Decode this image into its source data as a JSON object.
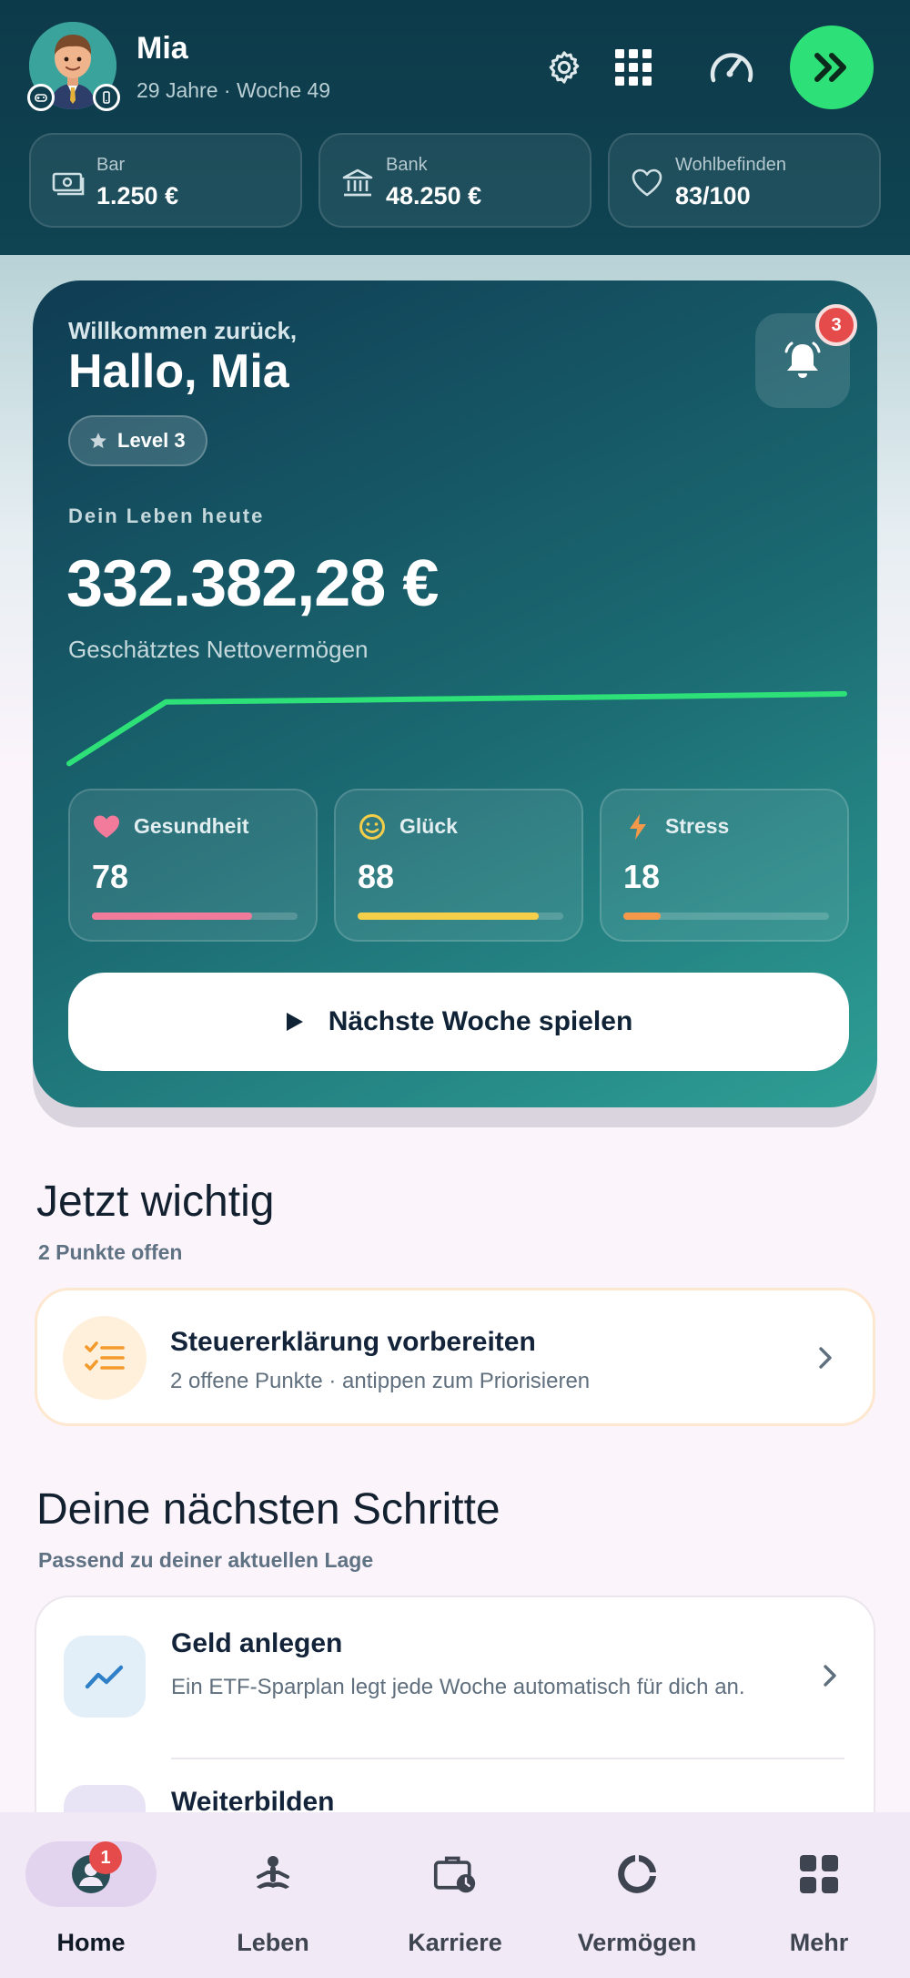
{
  "header": {
    "name": "Mia",
    "meta": "29 Jahre · Woche 49",
    "icons": [
      "gear-icon",
      "grid-icon",
      "speedometer-icon",
      "fast-forward-icon"
    ],
    "stats": [
      {
        "label": "Bar",
        "value": "1.250 €",
        "icon": "cash-icon"
      },
      {
        "label": "Bank",
        "value": "48.250 €",
        "icon": "bank-icon"
      },
      {
        "label": "Wohlbefinden",
        "value": "83/100",
        "icon": "heart-icon"
      }
    ]
  },
  "hero": {
    "welcome": "Willkommen zurück,",
    "greeting": "Hallo, Mia",
    "level": "Level 3",
    "notifications": "3",
    "life_label": "Dein Leben heute",
    "net_worth": "332.382,28 €",
    "net_worth_caption": "Geschätztes Nettovermögen",
    "trend": [
      0.12,
      0.58,
      0.59,
      0.6,
      0.61,
      0.62,
      0.63,
      0.64
    ],
    "metrics": [
      {
        "label": "Gesundheit",
        "value": "78",
        "level": 0.78,
        "color": "#f27a9b",
        "icon": "heart-icon"
      },
      {
        "label": "Glück",
        "value": "88",
        "level": 0.88,
        "color": "#f5cf4a",
        "icon": "smile-icon"
      },
      {
        "label": "Stress",
        "value": "18",
        "level": 0.18,
        "color": "#f4994a",
        "icon": "bolt-icon"
      }
    ],
    "play_label": "Nächste Woche spielen"
  },
  "important": {
    "title": "Jetzt wichtig",
    "subtitle": "2 Punkte offen",
    "task_title": "Steuererklärung vorbereiten",
    "task_sub": "2 offene Punkte · antippen zum Priorisieren"
  },
  "next_steps": {
    "title": "Deine nächsten Schritte",
    "subtitle": "Passend zu deiner aktuellen Lage",
    "items": [
      {
        "title": "Geld anlegen",
        "desc": "Ein ETF-Sparplan legt jede Woche automatisch für dich an."
      },
      {
        "title": "Weiterbilden",
        "desc": ""
      }
    ]
  },
  "nav": {
    "items": [
      {
        "label": "Home",
        "icon": "profile-icon",
        "badge": "1"
      },
      {
        "label": "Leben",
        "icon": "meditation-icon"
      },
      {
        "label": "Karriere",
        "icon": "briefcase-clock-icon"
      },
      {
        "label": "Vermögen",
        "icon": "donut-chart-icon"
      },
      {
        "label": "Mehr",
        "icon": "grid-icon"
      }
    ]
  },
  "colors": {
    "header_bg": "#0d3a4a",
    "accent_green": "#2ee078",
    "badge_red": "#e64b4b",
    "hero_start": "#0f3c53",
    "hero_end": "#2e9f95"
  }
}
